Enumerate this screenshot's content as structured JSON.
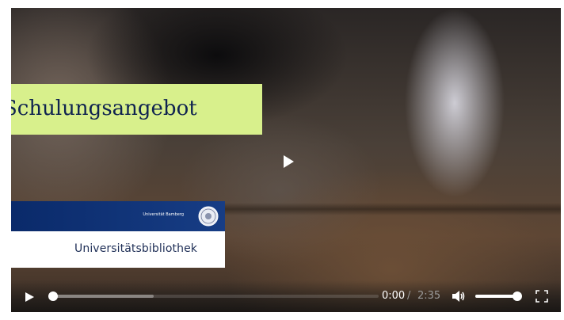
{
  "video": {
    "title_overlay": "Schulungsangebot",
    "logo_card": {
      "university": "Universität Bamberg",
      "library": "Universitätsbibliothek",
      "seal_icon": "university-seal-icon"
    },
    "center_play_icon": "play-icon"
  },
  "controls": {
    "play_icon": "play-icon",
    "progress_fraction": 0.0,
    "buffered_fraction": 0.31,
    "time_current": "0:00",
    "time_separator": "/",
    "time_total": "2:35",
    "volume_icon": "volume-icon",
    "volume_fraction": 0.95,
    "fullscreen_icon": "fullscreen-icon"
  },
  "colors": {
    "title_bg": "#d8f08c",
    "title_text": "#0f2350",
    "logo_bar": "#0a2a6a"
  }
}
